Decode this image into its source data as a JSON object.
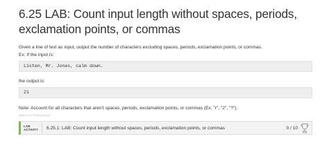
{
  "title": "6.25 LAB: Count input length without spaces, periods, exclamation points, or commas",
  "description": "Given a line of text as input, output the number of characters excluding spaces, periods, exclamation points, or commas.",
  "example_label": "Ex: If the input is:",
  "example_input": "Listen, Mr. Jones, calm down.",
  "output_label": "the output is:",
  "example_output": "21",
  "note": "Note: Account for all characters that aren't spaces, periods, exclamation points, or commas (Ex: \"r\", \"2\", \"?\").",
  "meta_id": "386614.4270186.qx3zqy7",
  "lab_bar": {
    "tag_line1": "LAB",
    "tag_line2": "ACTIVITY",
    "title": "6.25.1: LAB: Count input length without spaces, periods, exclamation points, or commas",
    "score": "0 / 10",
    "icon": "trophy-icon",
    "accent_color": "#7db94a"
  }
}
